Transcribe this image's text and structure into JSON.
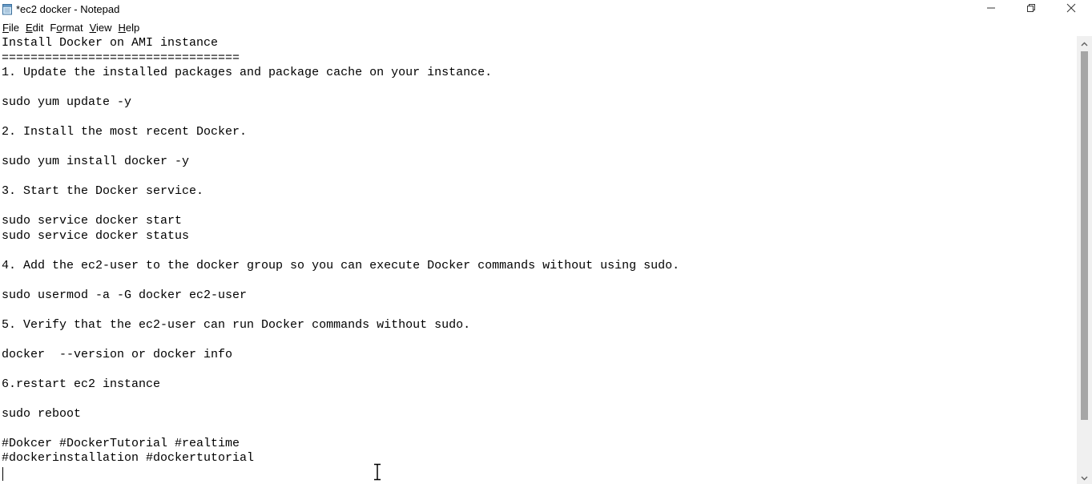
{
  "window": {
    "title": "*ec2 docker - Notepad",
    "icon": "notepad-icon",
    "controls": {
      "minimize_icon": "minimize-icon",
      "maximize_icon": "restore-icon",
      "close_icon": "close-icon"
    }
  },
  "menu": {
    "items": [
      {
        "label": "File",
        "mnemonic": "F",
        "rest": "ile"
      },
      {
        "label": "Edit",
        "mnemonic": "E",
        "rest": "dit"
      },
      {
        "label": "Format",
        "mnemonic": "F",
        "rest": "ormat",
        "prefix": ""
      },
      {
        "label": "View",
        "mnemonic": "V",
        "rest": "iew"
      },
      {
        "label": "Help",
        "mnemonic": "H",
        "rest": "elp"
      }
    ]
  },
  "editor": {
    "lines": [
      "Install Docker on AMI instance",
      "=================================",
      "1. Update the installed packages and package cache on your instance.",
      "",
      "sudo yum update -y",
      "",
      "2. Install the most recent Docker.",
      "",
      "sudo yum install docker -y",
      "",
      "3. Start the Docker service.",
      "",
      "sudo service docker start",
      "sudo service docker status",
      "",
      "4. Add the ec2-user to the docker group so you can execute Docker commands without using sudo.",
      "",
      "sudo usermod -a -G docker ec2-user",
      "",
      "5. Verify that the ec2-user can run Docker commands without sudo.",
      "",
      "docker  --version or docker info",
      "",
      "6.restart ec2 instance",
      "",
      "sudo reboot",
      "",
      "#Dokcer #DockerTutorial #realtime",
      "#dockerinstallation #dockertutorial",
      ""
    ]
  },
  "scrollbar": {
    "up_icon": "scroll-up-arrow-icon",
    "down_icon": "scroll-down-arrow-icon"
  }
}
